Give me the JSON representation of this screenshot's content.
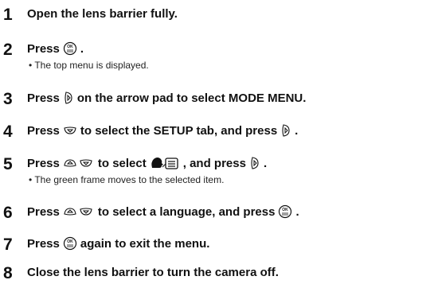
{
  "steps": [
    {
      "number": "1",
      "parts": [
        "Open the lens barrier fully."
      ]
    },
    {
      "number": "2",
      "parts": [
        "Press",
        "."
      ],
      "icons": [
        "ok-button-icon"
      ],
      "note": "• The top menu is displayed."
    },
    {
      "number": "3",
      "parts": [
        "Press",
        "on the arrow pad to select MODE MENU."
      ],
      "icons": [
        "arrow-right-icon"
      ]
    },
    {
      "number": "4",
      "parts": [
        "Press",
        "to select the SETUP tab, and press",
        "."
      ],
      "icons": [
        "arrow-down-icon",
        "arrow-right-icon"
      ]
    },
    {
      "number": "5",
      "parts": [
        "Press",
        "to select",
        ", and press",
        "."
      ],
      "icons": [
        "arrow-up-down-icon",
        "language-menu-icon",
        "arrow-right-icon"
      ],
      "note": "• The green frame moves to the selected item."
    },
    {
      "number": "6",
      "parts": [
        "Press",
        "to select a language, and press",
        "."
      ],
      "icons": [
        "arrow-up-down-icon",
        "ok-button-icon"
      ]
    },
    {
      "number": "7",
      "parts": [
        "Press",
        "again to exit the menu."
      ],
      "icons": [
        "ok-button-icon"
      ]
    },
    {
      "number": "8",
      "parts": [
        "Close the lens barrier to turn the camera off."
      ]
    }
  ]
}
